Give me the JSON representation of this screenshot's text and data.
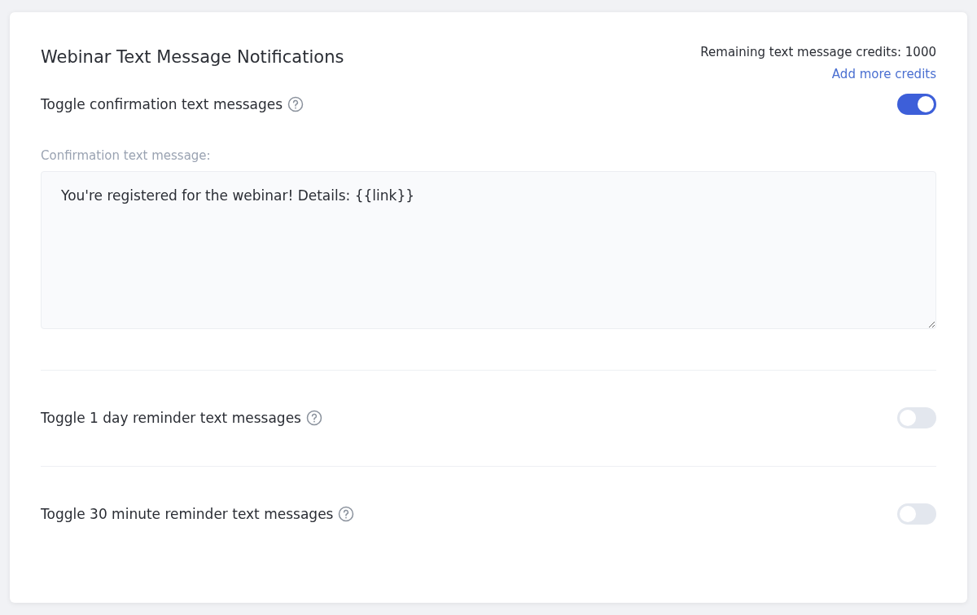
{
  "title": "Webinar Text Message Notifications",
  "credits": {
    "text": "Remaining text message credits: 1000",
    "link": "Add more credits"
  },
  "toggles": [
    {
      "label": "Toggle confirmation text messages",
      "on": true,
      "message_label": "Confirmation text message:",
      "message": "You're registered for the webinar! Details: {{link}}"
    },
    {
      "label": "Toggle 1 day reminder text messages",
      "on": false
    },
    {
      "label": "Toggle 30 minute reminder text messages",
      "on": false
    }
  ]
}
